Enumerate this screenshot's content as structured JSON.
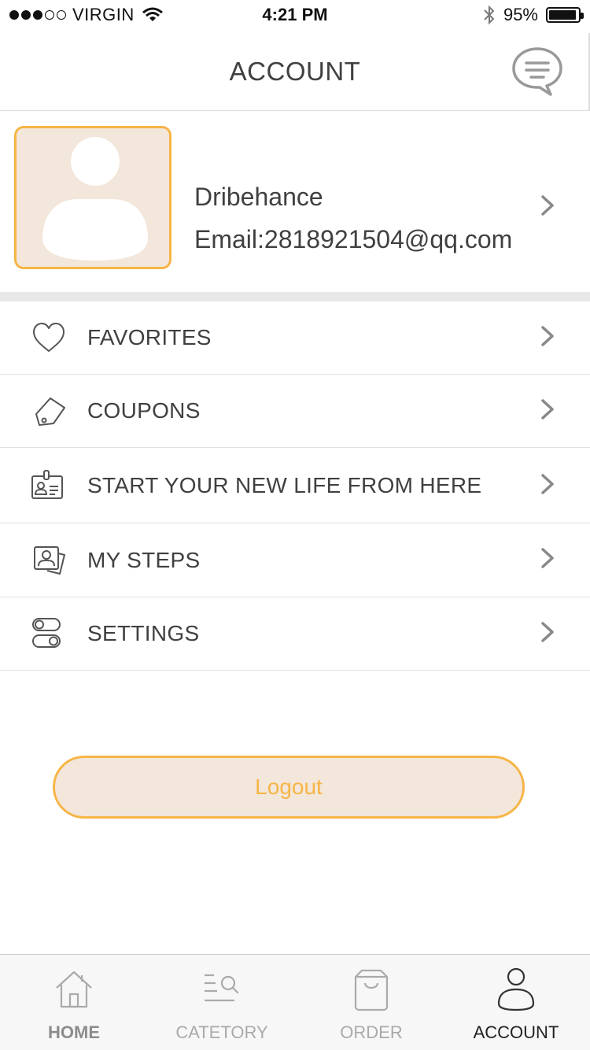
{
  "status_bar": {
    "carrier": "VIRGIN",
    "time": "4:21 PM",
    "battery": "95%",
    "battery_level": 0.95,
    "signal_bars_filled": 3,
    "signal_bars_total": 5
  },
  "nav": {
    "title": "ACCOUNT",
    "chat_icon": "chat-bubble-icon"
  },
  "profile": {
    "name": "Dribehance",
    "email": "Email:2818921504@qq.com",
    "avatar_icon": "user-avatar-icon"
  },
  "menu": {
    "items": [
      {
        "label": "FAVORITES",
        "icon": "heart-icon"
      },
      {
        "label": "COUPONS",
        "icon": "tag-icon"
      },
      {
        "label": "START YOUR NEW LIFE FROM HERE",
        "icon": "id-card-icon"
      },
      {
        "label": "MY STEPS",
        "icon": "photo-card-icon"
      },
      {
        "label": "SETTINGS",
        "icon": "toggle-icon"
      }
    ]
  },
  "logout": {
    "label": "Logout"
  },
  "tabs": [
    {
      "label": "HOME",
      "icon": "home-icon"
    },
    {
      "label": "CATETORY",
      "icon": "list-search-icon"
    },
    {
      "label": "ORDER",
      "icon": "shopping-bag-icon"
    },
    {
      "label": "ACCOUNT",
      "icon": "user-icon"
    }
  ],
  "colors": {
    "accent": "#f6b546",
    "accent_bg": "#f3e6da",
    "text": "#404040",
    "tab_inactive": "#aaaaaa",
    "tab_active": "#222222"
  }
}
